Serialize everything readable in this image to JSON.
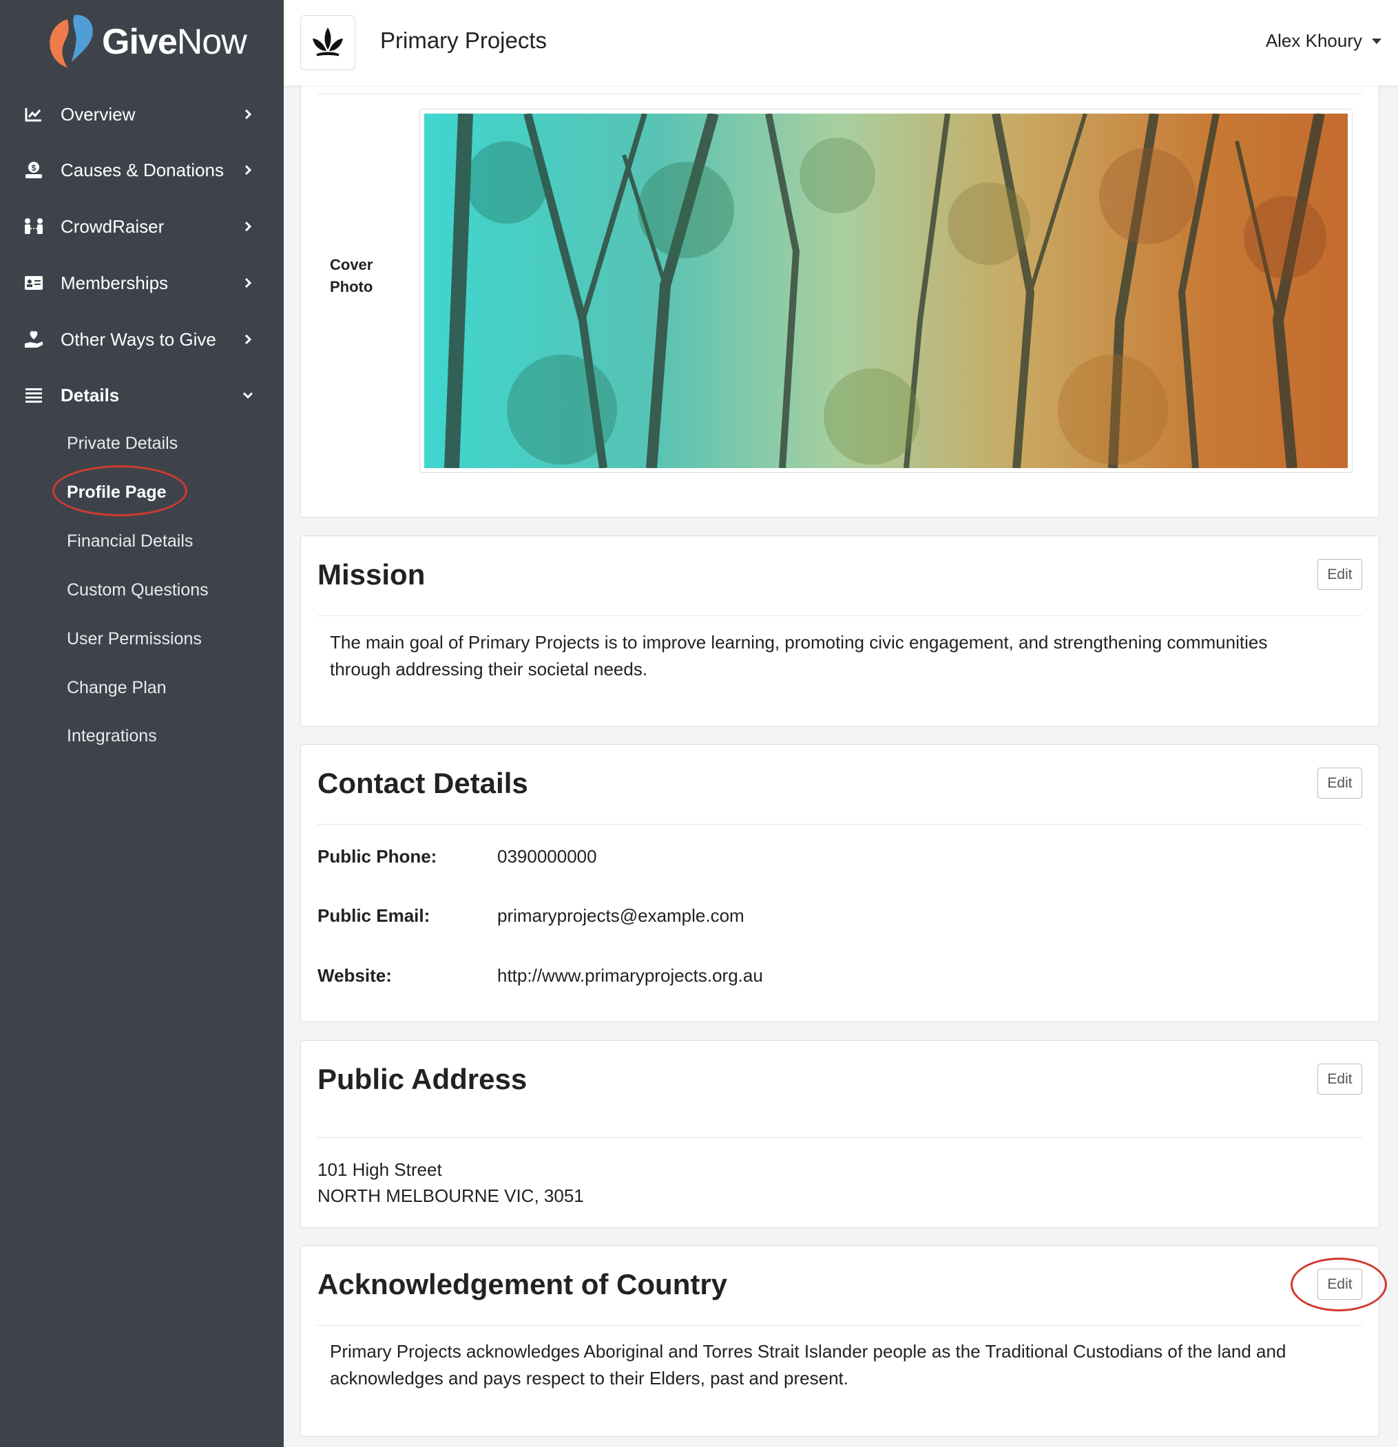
{
  "brand": {
    "name_bold": "Give",
    "name_light": "Now"
  },
  "sidebar": {
    "items": [
      {
        "label": "Overview",
        "icon": "chart-line-icon"
      },
      {
        "label": "Causes & Donations",
        "icon": "donation-icon"
      },
      {
        "label": "CrowdRaiser",
        "icon": "people-icon"
      },
      {
        "label": "Memberships",
        "icon": "id-card-icon"
      },
      {
        "label": "Other Ways to Give",
        "icon": "hand-heart-icon"
      },
      {
        "label": "Details",
        "icon": "list-icon"
      }
    ],
    "subitems": [
      {
        "label": "Private Details"
      },
      {
        "label": "Profile Page"
      },
      {
        "label": "Financial Details"
      },
      {
        "label": "Custom Questions"
      },
      {
        "label": "User Permissions"
      },
      {
        "label": "Change Plan"
      },
      {
        "label": "Integrations"
      }
    ]
  },
  "header": {
    "org_name": "Primary Projects",
    "user_name": "Alex Khoury"
  },
  "cover": {
    "label": "Cover Photo"
  },
  "mission": {
    "title": "Mission",
    "edit": "Edit",
    "text": "The main goal of Primary Projects is to improve learning, promoting civic engagement, and strengthening communities through addressing their societal needs."
  },
  "contact": {
    "title": "Contact Details",
    "edit": "Edit",
    "phone_label": "Public Phone:",
    "phone": "0390000000",
    "email_label": "Public Email:",
    "email": "primaryprojects@example.com",
    "website_label": "Website:",
    "website": "http://www.primaryprojects.org.au"
  },
  "address": {
    "title": "Public Address",
    "edit": "Edit",
    "line1": "101 High Street",
    "line2": "NORTH MELBOURNE VIC, 3051"
  },
  "acknowledgement": {
    "title": "Acknowledgement of Country",
    "edit": "Edit",
    "text": "Primary Projects acknowledges Aboriginal and Torres Strait Islander people as the Traditional Custodians of the land and acknowledges and pays respect to their Elders, past and present."
  },
  "colors": {
    "sidebar_bg": "#3e434b",
    "highlight_circle": "#d23a2f",
    "logo_orange": "#f07b4a",
    "logo_blue": "#4f9fd6"
  }
}
